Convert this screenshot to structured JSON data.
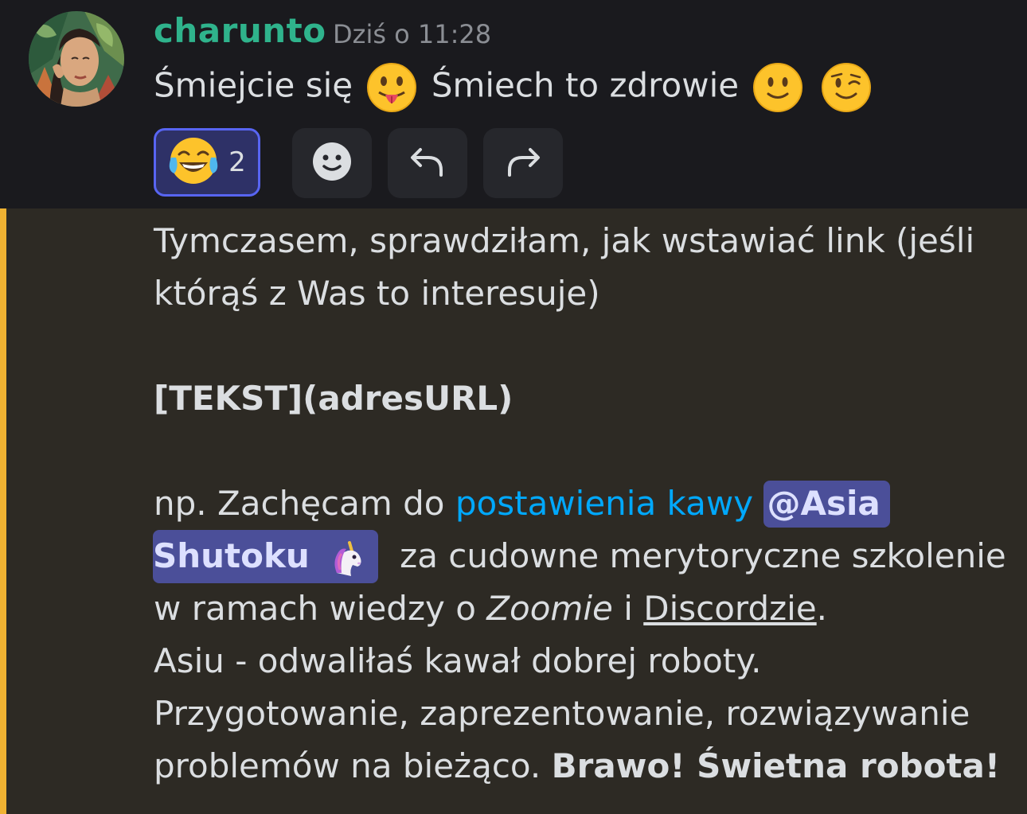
{
  "message": {
    "author": "charunto",
    "timestamp": "Dziś o 11:28",
    "text_part1": "Śmiejcie się",
    "text_part2": "Śmiech to zdrowie"
  },
  "reaction": {
    "emoji": "joy-icon",
    "count": "2"
  },
  "action_buttons": [
    "add-reaction-icon",
    "reply-icon",
    "forward-icon"
  ],
  "quote": {
    "line1": "Tymczasem, sprawdziłam, jak wstawiać link (jeśli",
    "line2": "którąś z Was to interesuje)",
    "code": "[TEKST](adresURL)",
    "example_prefix": "np. Zachęcam do",
    "link_text": "postawienia kawy",
    "mention_part1": "@Asia",
    "mention_part2": "Shutoku",
    "after_mention": "za cudowne merytoryczne szkolenie",
    "line_ramach_a": "w ramach wiedzy o",
    "italic_word": "Zoomie",
    "conj": "i",
    "underlined_word": "Discordzie",
    "period": ".",
    "line_asiu": "Asiu - odwaliłaś kawał dobrej roboty.",
    "line_przygot": "Przygotowanie, zaprezentowanie, rozwiązywanie",
    "line_problem": "problemów na bieżąco.",
    "bold_end": "Brawo! Świetna robota!"
  },
  "colors": {
    "username": "#2fb38c",
    "quote_bar": "#f0b232",
    "link": "#00a8fc",
    "mention_bg": "#4b4f99",
    "reaction_border": "#5865f2"
  }
}
